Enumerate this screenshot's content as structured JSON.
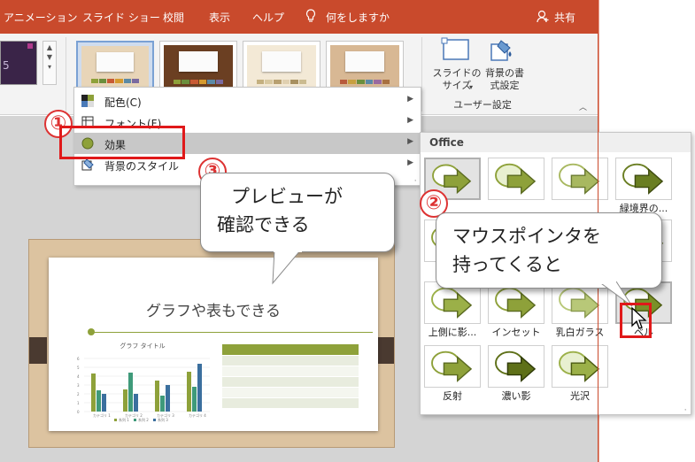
{
  "tabs": [
    {
      "label": "アニメーション"
    },
    {
      "label": "スライド ショー"
    },
    {
      "label": "校閲"
    },
    {
      "label": "表示"
    },
    {
      "label": "ヘルプ"
    },
    {
      "label": "何をしますか"
    },
    {
      "label": "共有"
    }
  ],
  "ribbon": {
    "slide_size": "スライドの\nサイズ",
    "bg_format": "背景の書\n式設定",
    "group_label": "ユーザー設定"
  },
  "menu": {
    "items": [
      {
        "label": "配色(C)"
      },
      {
        "label": "フォント(F)"
      },
      {
        "label": "効果"
      },
      {
        "label": "背景のスタイル"
      }
    ]
  },
  "gallery": {
    "header": "Office",
    "effects": [
      {
        "label": ""
      },
      {
        "label": ""
      },
      {
        "label": ""
      },
      {
        "label": "緑境界の..."
      },
      {
        "label": "ス"
      },
      {
        "label": ""
      },
      {
        "label": ""
      },
      {
        "label": "ラス"
      },
      {
        "label": "上側に影..."
      },
      {
        "label": "インセット"
      },
      {
        "label": "乳白ガラス"
      },
      {
        "label": "ベル"
      },
      {
        "label": "反射"
      },
      {
        "label": "濃い影"
      },
      {
        "label": "光沢"
      }
    ]
  },
  "slide": {
    "title": "グラフや表もできる",
    "chart_title": "グラフ タイトル",
    "categories": [
      "カテゴリ 1",
      "カテゴリ 2",
      "カテゴリ 3",
      "カテゴリ 4"
    ],
    "legend": [
      "系列 1",
      "系列 2",
      "系列 3"
    ],
    "yticks": [
      "6",
      "5",
      "4",
      "3",
      "2",
      "1",
      "0"
    ]
  },
  "callouts": {
    "step1": "①",
    "step2": "②",
    "step3": "③",
    "preview_line1": "プレビューが",
    "preview_line2": "確認できる",
    "pointer_line1": "マウスポインタを",
    "pointer_line2": "持ってくると"
  },
  "colors": {
    "ribbon_accent": "#c94a2c",
    "effect_green": "#8ea13a",
    "highlight_red": "#e0191a"
  }
}
